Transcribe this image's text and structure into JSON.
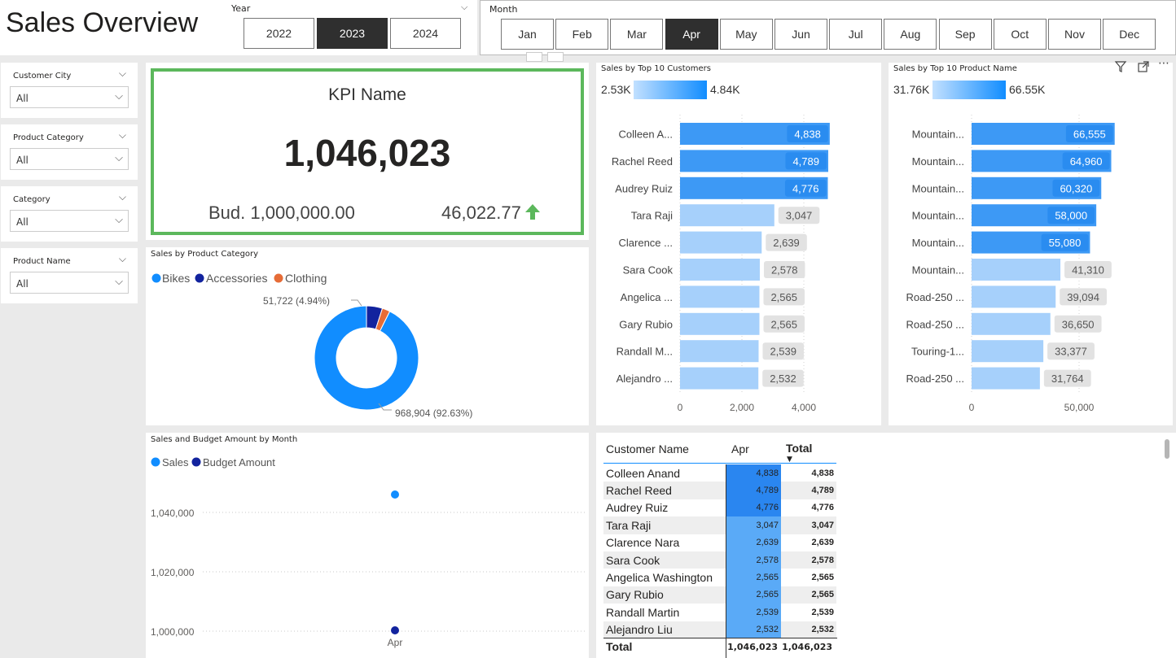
{
  "header": {
    "title": "Sales Overview"
  },
  "year_slicer": {
    "label": "Year",
    "options": [
      "2022",
      "2023",
      "2024"
    ],
    "selected": "2023"
  },
  "month_slicer": {
    "label": "Month",
    "options": [
      "Jan",
      "Feb",
      "Mar",
      "Apr",
      "May",
      "Jun",
      "Jul",
      "Aug",
      "Sep",
      "Oct",
      "Nov",
      "Dec"
    ],
    "selected": "Apr"
  },
  "filters": [
    {
      "label": "Customer City",
      "value": "All"
    },
    {
      "label": "Product Category",
      "value": "All"
    },
    {
      "label": "Category",
      "value": "All"
    },
    {
      "label": "Product Name",
      "value": "All"
    }
  ],
  "kpi": {
    "name": "KPI Name",
    "value": "1,046,023",
    "budget": "Bud. 1,000,000.00",
    "variance": "46,022.77",
    "trend": "up-arrow-icon",
    "accent": "#5cb85c"
  },
  "product_category": {
    "title": "Sales by Product Category",
    "legend": [
      {
        "name": "Bikes",
        "color": "#118dff"
      },
      {
        "name": "Accessories",
        "color": "#12239e"
      },
      {
        "name": "Clothing",
        "color": "#e66c37"
      }
    ],
    "label_small": "51,722 (4.94%)",
    "label_large": "968,904 (92.63%)",
    "slices": [
      968904,
      51722,
      25397
    ]
  },
  "top_customers": {
    "title": "Sales by Top 10 Customers",
    "gradient_min": "2.53K",
    "gradient_max": "4.84K",
    "categories": [
      "Colleen A...",
      "Rachel Reed",
      "Audrey Ruiz",
      "Tara Raji",
      "Clarence ...",
      "Sara Cook",
      "Angelica ...",
      "Gary Rubio",
      "Randall M...",
      "Alejandro ..."
    ],
    "values": [
      4838,
      4789,
      4776,
      3047,
      2639,
      2578,
      2565,
      2565,
      2539,
      2532
    ],
    "value_labels": [
      "4,838",
      "4,789",
      "4,776",
      "3,047",
      "2,639",
      "2,578",
      "2,565",
      "2,565",
      "2,539",
      "2,532"
    ],
    "axis_ticks": [
      "0",
      "2,000",
      "4,000"
    ],
    "tick_values": [
      0,
      2000,
      4000
    ],
    "xmax": 4838
  },
  "top_products": {
    "title": "Sales by Top 10 Product Name",
    "gradient_min": "31.76K",
    "gradient_max": "66.55K",
    "categories": [
      "Mountain...",
      "Mountain...",
      "Mountain...",
      "Mountain...",
      "Mountain...",
      "Mountain...",
      "Road-250 ...",
      "Road-250 ...",
      "Touring-1...",
      "Road-250 ..."
    ],
    "values": [
      66555,
      64960,
      60320,
      58000,
      55080,
      41310,
      39094,
      36650,
      33377,
      31764
    ],
    "value_labels": [
      "66,555",
      "64,960",
      "60,320",
      "58,000",
      "55,080",
      "41,310",
      "39,094",
      "36,650",
      "33,377",
      "31,764"
    ],
    "axis_ticks": [
      "0",
      "50,000"
    ],
    "tick_values": [
      0,
      50000
    ],
    "xmax": 66555
  },
  "monthly": {
    "title": "Sales and Budget Amount by Month",
    "legend": [
      {
        "name": "Sales",
        "color": "#118dff"
      },
      {
        "name": "Budget Amount",
        "color": "#12239e"
      }
    ],
    "y_ticks": [
      "1,040,000",
      "1,020,000",
      "1,000,000"
    ],
    "x_label": "Apr"
  },
  "matrix": {
    "headers": {
      "name": "Customer Name",
      "month": "Apr",
      "total": "Total"
    },
    "rows": [
      {
        "name": "Colleen Anand",
        "apr": "4,838",
        "total": "4,838"
      },
      {
        "name": "Rachel Reed",
        "apr": "4,789",
        "total": "4,789"
      },
      {
        "name": "Audrey Ruiz",
        "apr": "4,776",
        "total": "4,776"
      },
      {
        "name": "Tara Raji",
        "apr": "3,047",
        "total": "3,047"
      },
      {
        "name": "Clarence Nara",
        "apr": "2,639",
        "total": "2,639"
      },
      {
        "name": "Sara Cook",
        "apr": "2,578",
        "total": "2,578"
      },
      {
        "name": "Angelica Washington",
        "apr": "2,565",
        "total": "2,565"
      },
      {
        "name": "Gary Rubio",
        "apr": "2,565",
        "total": "2,565"
      },
      {
        "name": "Randall Martin",
        "apr": "2,539",
        "total": "2,539"
      },
      {
        "name": "Alejandro Liu",
        "apr": "2,532",
        "total": "2,532"
      }
    ],
    "total_label": "Total",
    "total_apr": "1,046,023",
    "total_total": "1,046,023"
  },
  "chart_data": [
    {
      "type": "bar",
      "title": "Sales by Top 10 Customers",
      "categories": [
        "Colleen A...",
        "Rachel Reed",
        "Audrey Ruiz",
        "Tara Raji",
        "Clarence ...",
        "Sara Cook",
        "Angelica ...",
        "Gary Rubio",
        "Randall M...",
        "Alejandro ..."
      ],
      "values": [
        4838,
        4789,
        4776,
        3047,
        2639,
        2578,
        2565,
        2565,
        2539,
        2532
      ],
      "xlim": [
        0,
        5000
      ]
    },
    {
      "type": "bar",
      "title": "Sales by Top 10 Product Name",
      "categories": [
        "Mountain...",
        "Mountain...",
        "Mountain...",
        "Mountain...",
        "Mountain...",
        "Mountain...",
        "Road-250 ...",
        "Road-250 ...",
        "Touring-1...",
        "Road-250 ..."
      ],
      "values": [
        66555,
        64960,
        60320,
        58000,
        55080,
        41310,
        39094,
        36650,
        33377,
        31764
      ],
      "xlim": [
        0,
        70000
      ]
    },
    {
      "type": "pie",
      "title": "Sales by Product Category",
      "categories": [
        "Bikes",
        "Accessories",
        "Clothing"
      ],
      "values": [
        968904,
        51722,
        25397
      ]
    },
    {
      "type": "scatter",
      "title": "Sales and Budget Amount by Month",
      "categories": [
        "Apr"
      ],
      "series": [
        {
          "name": "Sales",
          "values": [
            1046023
          ]
        },
        {
          "name": "Budget Amount",
          "values": [
            1000000
          ]
        }
      ],
      "ylim": [
        998000,
        1050000
      ]
    }
  ]
}
